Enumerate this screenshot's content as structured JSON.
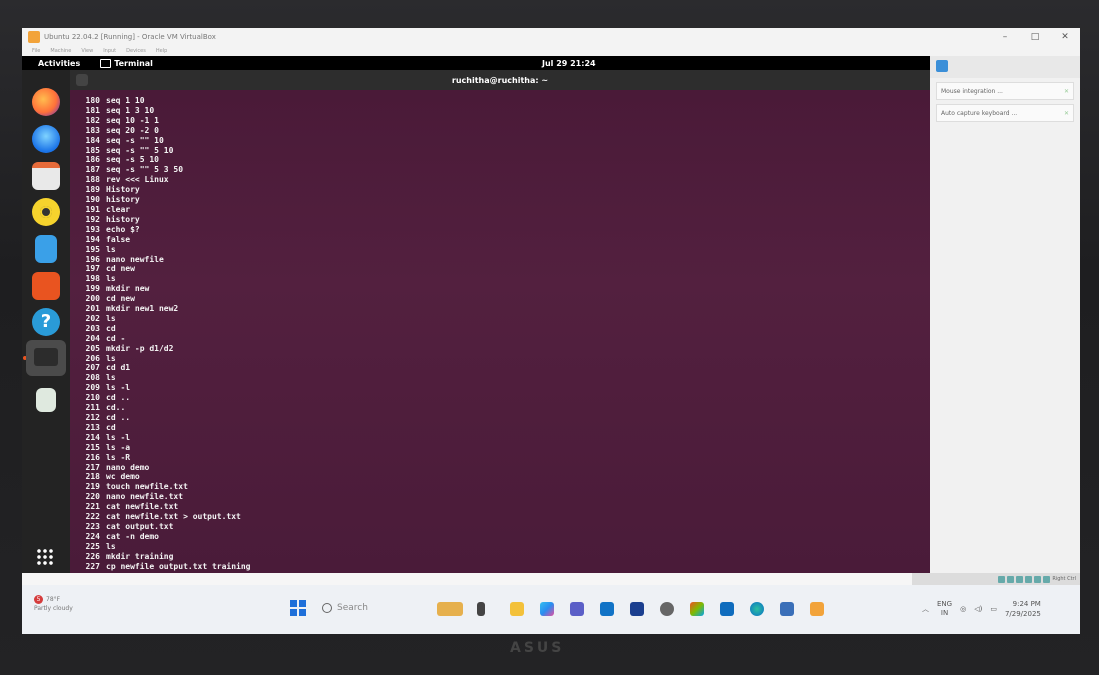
{
  "vbox": {
    "title": "Ubuntu 22.04.2 [Running] - Oracle VM VirtualBox",
    "menu": [
      "File",
      "Machine",
      "View",
      "Input",
      "Devices",
      "Help"
    ],
    "notifications": [
      "Mouse integration ...",
      "Auto capture keyboard ..."
    ],
    "host_key": "Right Ctrl"
  },
  "ubuntu": {
    "activities": "Activities",
    "app_name": "Terminal",
    "clock": "Jul 29 21:24"
  },
  "terminal": {
    "title": "ruchitha@ruchitha: ~",
    "history": [
      {
        "n": "180",
        "cmd": "seq 1 10"
      },
      {
        "n": "181",
        "cmd": "seq 1 3 10"
      },
      {
        "n": "182",
        "cmd": "seq 10 -1 1"
      },
      {
        "n": "183",
        "cmd": "seq 20 -2 0"
      },
      {
        "n": "184",
        "cmd": "seq -s \"\" 10"
      },
      {
        "n": "185",
        "cmd": "seq -s \"\" 5 10"
      },
      {
        "n": "186",
        "cmd": "seq -s 5 10"
      },
      {
        "n": "187",
        "cmd": "seq -s \"\" 5 3 50"
      },
      {
        "n": "188",
        "cmd": "rev <<< Linux"
      },
      {
        "n": "189",
        "cmd": "History"
      },
      {
        "n": "190",
        "cmd": "history"
      },
      {
        "n": "191",
        "cmd": "clear"
      },
      {
        "n": "192",
        "cmd": "history"
      },
      {
        "n": "193",
        "cmd": "echo $?"
      },
      {
        "n": "194",
        "cmd": "false"
      },
      {
        "n": "195",
        "cmd": "ls"
      },
      {
        "n": "196",
        "cmd": "nano newfile"
      },
      {
        "n": "197",
        "cmd": "cd new"
      },
      {
        "n": "198",
        "cmd": "ls"
      },
      {
        "n": "199",
        "cmd": "mkdir new"
      },
      {
        "n": "200",
        "cmd": "cd new"
      },
      {
        "n": "201",
        "cmd": "mkdir new1 new2"
      },
      {
        "n": "202",
        "cmd": "ls"
      },
      {
        "n": "203",
        "cmd": "cd"
      },
      {
        "n": "204",
        "cmd": "cd -"
      },
      {
        "n": "205",
        "cmd": "mkdir -p d1/d2"
      },
      {
        "n": "206",
        "cmd": "ls"
      },
      {
        "n": "207",
        "cmd": "cd d1"
      },
      {
        "n": "208",
        "cmd": "ls"
      },
      {
        "n": "209",
        "cmd": "ls -l"
      },
      {
        "n": "210",
        "cmd": "cd .."
      },
      {
        "n": "211",
        "cmd": "cd.."
      },
      {
        "n": "212",
        "cmd": "cd .."
      },
      {
        "n": "213",
        "cmd": "cd"
      },
      {
        "n": "214",
        "cmd": "ls -l"
      },
      {
        "n": "215",
        "cmd": "ls -a"
      },
      {
        "n": "216",
        "cmd": "ls -R"
      },
      {
        "n": "217",
        "cmd": "nano demo"
      },
      {
        "n": "218",
        "cmd": "wc demo"
      },
      {
        "n": "219",
        "cmd": "touch newfile.txt"
      },
      {
        "n": "220",
        "cmd": "nano newfile.txt"
      },
      {
        "n": "221",
        "cmd": "cat newfile.txt"
      },
      {
        "n": "222",
        "cmd": "cat newfile.txt > output.txt"
      },
      {
        "n": "223",
        "cmd": "cat output.txt"
      },
      {
        "n": "224",
        "cmd": "cat -n demo"
      },
      {
        "n": "225",
        "cmd": "ls"
      },
      {
        "n": "226",
        "cmd": "mkdir training"
      },
      {
        "n": "227",
        "cmd": "cp newfile output.txt training"
      }
    ]
  },
  "windows": {
    "weather_temp": "78°F",
    "weather_desc": "Partly cloudy",
    "weather_badge": "5",
    "search_placeholder": "Search",
    "lang": "ENG",
    "region": "IN",
    "time": "9:24 PM",
    "date": "7/29/2025"
  },
  "laptop": {
    "brand": "ASUS"
  },
  "colors": {
    "terminal_bg": "#4e1e3c",
    "ubuntu_orange": "#e95420"
  }
}
